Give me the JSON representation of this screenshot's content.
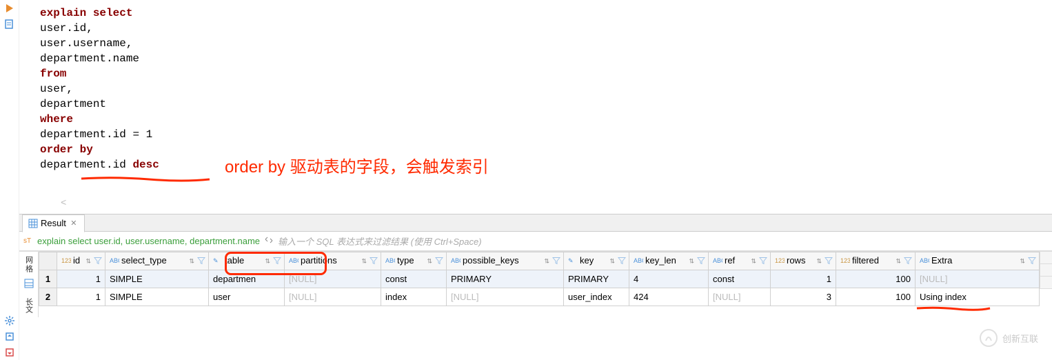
{
  "editor": {
    "lines": [
      [
        {
          "t": "explain select",
          "c": "kw"
        }
      ],
      [
        {
          "t": "    user",
          "c": "ident"
        },
        {
          "t": ".",
          "c": "dot"
        },
        {
          "t": "id",
          "c": "ident"
        },
        {
          "t": ",",
          "c": "ident"
        }
      ],
      [
        {
          "t": "    user",
          "c": "ident"
        },
        {
          "t": ".",
          "c": "dot"
        },
        {
          "t": "username",
          "c": "ident"
        },
        {
          "t": ",",
          "c": "ident"
        }
      ],
      [
        {
          "t": "    department",
          "c": "ident"
        },
        {
          "t": ".",
          "c": "dot"
        },
        {
          "t": "name",
          "c": "ident"
        }
      ],
      [
        {
          "t": "from",
          "c": "kw"
        }
      ],
      [
        {
          "t": "    user",
          "c": "ident"
        },
        {
          "t": ",",
          "c": "ident"
        }
      ],
      [
        {
          "t": "    department",
          "c": "ident"
        }
      ],
      [
        {
          "t": "where",
          "c": "kw"
        }
      ],
      [
        {
          "t": "    department",
          "c": "ident"
        },
        {
          "t": ".",
          "c": "dot"
        },
        {
          "t": "id ",
          "c": "ident"
        },
        {
          "t": "= ",
          "c": "ident"
        },
        {
          "t": "1",
          "c": "num"
        }
      ],
      [
        {
          "t": "order by",
          "c": "kw"
        }
      ],
      [
        {
          "t": "    department",
          "c": "ident"
        },
        {
          "t": ".",
          "c": "dot"
        },
        {
          "t": "id ",
          "c": "ident"
        },
        {
          "t": "desc",
          "c": "kw"
        }
      ]
    ],
    "annotation": "order by 驱动表的字段，会触发索引"
  },
  "result_tab": {
    "label": "Result"
  },
  "filter": {
    "sql_preview": "explain select user.id, user.username, department.name",
    "placeholder": "输入一个 SQL 表达式来过滤结果 (使用 Ctrl+Space)"
  },
  "grid": {
    "columns": [
      "id",
      "select_type",
      "table",
      "partitions",
      "type",
      "possible_keys",
      "key",
      "key_len",
      "ref",
      "rows",
      "filtered",
      "Extra"
    ],
    "col_types": [
      "num",
      "text",
      "text",
      "text",
      "text",
      "text",
      "text",
      "text",
      "text",
      "num",
      "num",
      "text"
    ],
    "rows": [
      {
        "n": "1",
        "cells": [
          "1",
          "SIMPLE",
          "departmen",
          "[NULL]",
          "const",
          "PRIMARY",
          "PRIMARY",
          "4",
          "const",
          "1",
          "100",
          "[NULL]"
        ]
      },
      {
        "n": "2",
        "cells": [
          "1",
          "SIMPLE",
          "user",
          "[NULL]",
          "index",
          "[NULL]",
          "user_index",
          "424",
          "[NULL]",
          "3",
          "100",
          "Using index"
        ]
      }
    ]
  },
  "gutter": {
    "vtext": "网格"
  },
  "watermark": {
    "text": "创新互联"
  },
  "colors": {
    "annotation": "#ff2a00",
    "keyword": "#880000",
    "sql_preview": "#3a9e3a"
  }
}
